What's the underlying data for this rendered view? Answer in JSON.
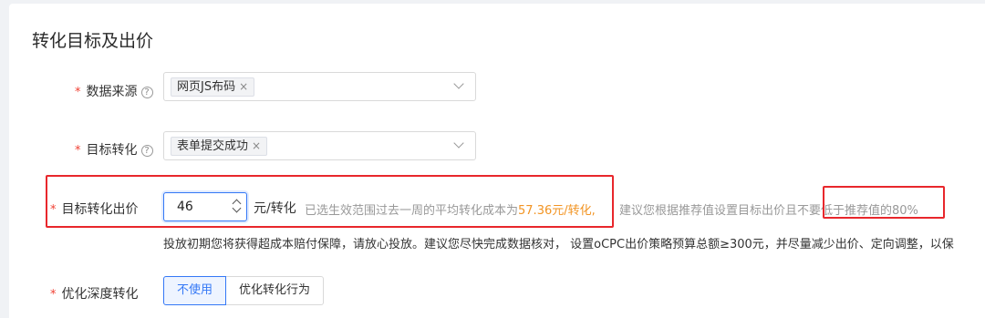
{
  "section": {
    "title": "转化目标及出价"
  },
  "form": {
    "data_source": {
      "label": "数据来源",
      "tag": "网页JS布码"
    },
    "target_conversion": {
      "label": "目标转化",
      "tag": "表单提交成功"
    },
    "target_bid": {
      "label": "目标转化出价",
      "value": "46",
      "unit": "元/转化",
      "hint_prefix": "已选生效范围过去一周的平均转化成本为",
      "hint_cost": "57.36元/转化",
      "hint_comma": ",",
      "hint_suggest": "建议您根据推荐值设置目标出价且不要低于推荐值的80%",
      "note": "投放初期您将获得超成本赔付保障，请放心投放。建议您尽快完成数据核对， 设置oCPC出价策略预算总额≥300元，并尽量减少出价、定向调整，以保"
    },
    "deep_conversion": {
      "label": "优化深度转化",
      "options": [
        "不使用",
        "优化转化行为"
      ],
      "selected": "不使用"
    }
  },
  "required_mark": "*",
  "help_glyph": "?",
  "remove_glyph": "×",
  "colors": {
    "primary": "#3478f6",
    "required": "#f04134",
    "highlight": "#f29423",
    "annotation": "#e8272c"
  }
}
